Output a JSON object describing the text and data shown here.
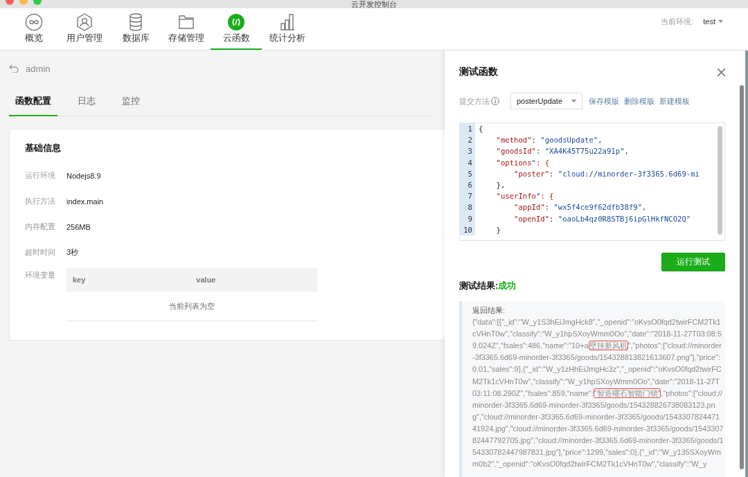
{
  "window": {
    "title": "云开发控制台"
  },
  "nav": [
    {
      "label": "概览",
      "selected": false
    },
    {
      "label": "用户管理",
      "selected": false
    },
    {
      "label": "数据库",
      "selected": false
    },
    {
      "label": "存储管理",
      "selected": false
    },
    {
      "label": "云函数",
      "selected": true
    },
    {
      "label": "统计分析",
      "selected": false
    }
  ],
  "environment": {
    "label": "当前环境:",
    "value": "test"
  },
  "function": {
    "name": "admin"
  },
  "tabs": [
    {
      "label": "函数配置",
      "selected": true
    },
    {
      "label": "日志",
      "selected": false
    },
    {
      "label": "监控",
      "selected": false
    }
  ],
  "basic_info": {
    "title": "基础信息",
    "fields": [
      {
        "label": "运行环境",
        "value": "Nodejs8.9"
      },
      {
        "label": "执行方法",
        "value": "index.main"
      },
      {
        "label": "内存配置",
        "value": "256MB"
      },
      {
        "label": "超时时间",
        "value": "3秒"
      }
    ],
    "env_vars": {
      "label": "环境变量",
      "columns": [
        "key",
        "value"
      ],
      "empty_text": "当前列表为空"
    }
  },
  "test_panel": {
    "title": "测试函数",
    "method_label": "提交方法",
    "method_value": "posterUpdate",
    "actions": [
      "保存模版",
      "删除模版",
      "新建模板"
    ],
    "code_lines": [
      {
        "number": "1",
        "text": "{"
      },
      {
        "number": "2",
        "text": "    \"method\": \"goodsUpdate\","
      },
      {
        "number": "3",
        "text": "    \"goodsId\": \"XA4K45T75u22a91p\","
      },
      {
        "number": "4",
        "text": "    \"options\": {"
      },
      {
        "number": "5",
        "text": "        \"poster\": \"cloud://minorder-3f3365.6d69-mi"
      },
      {
        "number": "6",
        "text": "    },"
      },
      {
        "number": "7",
        "text": "    \"userInfo\": {"
      },
      {
        "number": "8",
        "text": "        \"appId\": \"wx5f4ce9f62dfb38f9\","
      },
      {
        "number": "9",
        "text": "        \"openId\": \"oaoLb4qz0R8STBj6ipGlHkfNCO2Q\""
      },
      {
        "number": "10",
        "text": "    }"
      }
    ],
    "run_button": "运行测试",
    "result_label": "测试结果:",
    "result_status": "成功",
    "return_label": "返回结果:",
    "return_segments": [
      {
        "text": "{\"data\":[{\"_id\":\"W_y1S3hEiJmgHck8\",\"_openid\":\"oKvsO0fqd2twirFCM2Tk1cVHnT0w\",\"classify\":\"W_y1hpSXoyWmm0Oo\",\"date\":\"2018-11-27T03:08:59.024Z\",\"fsales\":486,\"name\":\"10+a",
        "highlighted": false
      },
      {
        "text": "壁挂新风机",
        "highlighted": true
      },
      {
        "text": "\",\"photos\":[\"cloud://minorder-3f3365.6d69-minorder-3f3365/goods/154328813821613607.png\"],\"price\":0.01,\"sales\":9},{\"_id\":\"W_y1zHhEiJmgHc3z\",\"_openid\":\"oKvsO0fqd2twirFCM2Tk1cVHnT0w\",\"classify\":\"W_y1hpSXoyWmm0Oo\",\"date\":\"2018-11-27T03:11:08.290Z\",\"fsales\":859,\"name\":",
        "highlighted": false
      },
      {
        "text": "\"智造曜石智能门锁\"",
        "highlighted": true
      },
      {
        "text": ",\"photos\":[\"cloud://minorder-3f3365.6d69-minorder-3f3365/goods/154328826738083123.png\",\"cloud://minorder-3f3365.6d69-minorder-3f3365/goods/154330782447141924.jpg\",\"cloud://minorder-3f3365.6d69-minorder-3f3365/goods/154330782447792705.jpg\",\"cloud://minorder-3f3365.6d69-minorder-3f3365/goods/154330782447987831.jpg\"],\"price\":1299,\"sales\":0},{\"_id\":\"W_y135SXoyWmm0b2\",\"_openid\":\"oKvsO0fqd2twirFCM2Tk1cVHnT0w\",\"classify\":\"W_y",
        "highlighted": false
      }
    ]
  }
}
